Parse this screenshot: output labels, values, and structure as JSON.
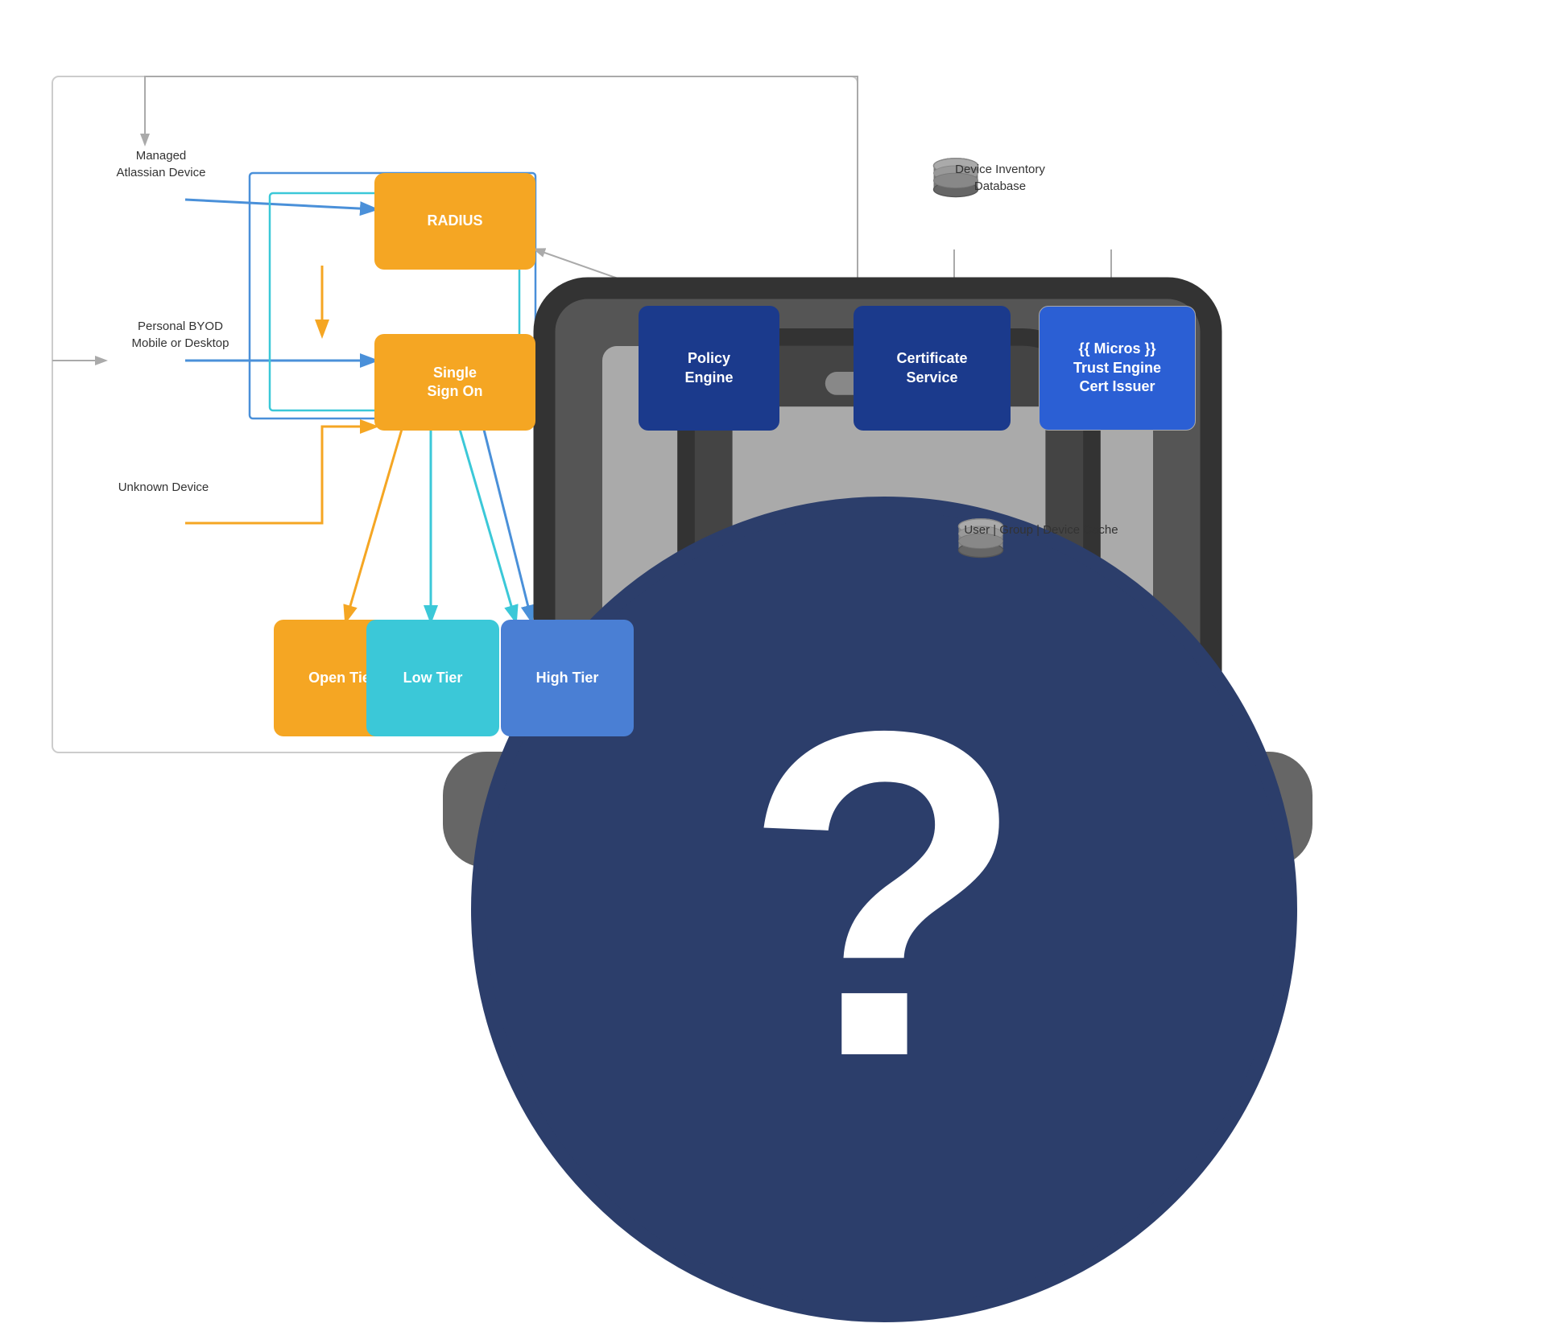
{
  "nodes": {
    "radius": {
      "label": "RADIUS",
      "color": "orange"
    },
    "sso": {
      "label": "Single\nSign On",
      "color": "orange"
    },
    "open_tier": {
      "label": "Open Tier",
      "color": "orange"
    },
    "low_tier": {
      "label": "Low Tier",
      "color": "cyan"
    },
    "high_tier": {
      "label": "High Tier",
      "color": "blue_mid"
    },
    "policy_engine": {
      "label": "Policy\nEngine",
      "color": "blue_dark"
    },
    "certificate_service": {
      "label": "Certificate\nService",
      "color": "blue_dark"
    },
    "trust_engine": {
      "label": "{{ Micros }}\nTrust Engine\nCert Issuer",
      "color": "blue_dark"
    }
  },
  "labels": {
    "managed_device": "Managed\nAtlassian Device",
    "byod": "Personal BYOD\nMobile or Desktop",
    "unknown": "Unknown Device",
    "device_inventory": "Device Inventory\nDatabase",
    "user_group_cache": "User | Group | Device Cache"
  },
  "colors": {
    "orange": "#F5A623",
    "blue_dark": "#1B3A8C",
    "blue_mid": "#3B6FD4",
    "cyan": "#3BC8D8",
    "arrow_blue": "#4A90D9",
    "arrow_cyan": "#3BC8D8",
    "arrow_orange": "#F5A623",
    "arrow_gray": "#999",
    "border_gray": "#ccc"
  }
}
